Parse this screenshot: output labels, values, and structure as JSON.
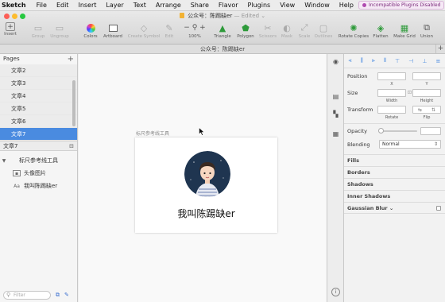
{
  "menubar": {
    "apple": "",
    "app": "Sketch",
    "items": [
      "File",
      "Edit",
      "Insert",
      "Layer",
      "Text",
      "Arrange",
      "Share",
      "Flavor",
      "Plugins",
      "View",
      "Window",
      "Help"
    ],
    "plugins_badge": "Incompatible Plugins Disabled"
  },
  "titlebar": {
    "title": "公众号：陈踢缺er",
    "edited": "— Edited ⌄"
  },
  "toolbar": {
    "insert": "Insert",
    "group": "Group",
    "ungroup": "Ungroup",
    "colors": "Colors",
    "artboard": "Artboard",
    "create_symbol": "Create Symbol",
    "edit": "Edit",
    "zoom": "100%",
    "triangle": "Triangle",
    "polygon": "Polygon",
    "scissors": "Scissors",
    "mask": "Mask",
    "scale": "Scale",
    "outlines": "Outlines",
    "rotate_copies": "Rotate Copies",
    "flatten": "Flatten",
    "make_grid": "Make Grid",
    "union": "Union"
  },
  "doctab": {
    "title": "公众号：陈踢缺er",
    "plus": "+"
  },
  "pages": {
    "header": "Pages",
    "add": "+",
    "items": [
      {
        "label": "文章2"
      },
      {
        "label": "文章3"
      },
      {
        "label": "文章4"
      },
      {
        "label": "文章5"
      },
      {
        "label": "文章6"
      },
      {
        "label": "文章7"
      }
    ],
    "current": "文章7"
  },
  "layers": {
    "artboard": "标尺参考线工具",
    "image": "头像图片",
    "text": "我叫陈踢缺er"
  },
  "filter": {
    "placeholder": "Filter"
  },
  "canvas": {
    "artboard_label": "标尺参考线工具",
    "name_text": "我叫陈踢缺er"
  },
  "inspector": {
    "position": "Position",
    "x": "X",
    "y": "Y",
    "size": "Size",
    "width": "Width",
    "height": "Height",
    "transform": "Transform",
    "rotate": "Rotate",
    "flip": "Flip",
    "opacity": "Opacity",
    "blending": "Blending",
    "blending_value": "Normal",
    "fills": "Fills",
    "borders": "Borders",
    "shadows": "Shadows",
    "inner_shadows": "Inner Shadows",
    "gaussian_blur": "Gaussian Blur ⌄"
  },
  "colors": {
    "selection": "#4a8be0",
    "avatar_bg": "#1f3550"
  }
}
